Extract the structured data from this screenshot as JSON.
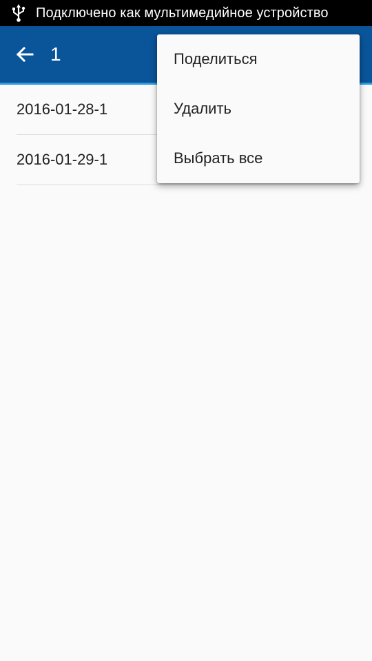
{
  "status_bar": {
    "icon": "usb-icon",
    "text": "Подключено как мультимедийное устройство"
  },
  "app_bar": {
    "back_icon": "arrow-left-icon",
    "title": "1",
    "color": "#0a5499",
    "accent": "#2f9be0"
  },
  "list": {
    "items": [
      {
        "label": "2016-01-28-1"
      },
      {
        "label": "2016-01-29-1"
      }
    ]
  },
  "menu": {
    "items": [
      {
        "label": "Поделиться"
      },
      {
        "label": "Удалить"
      },
      {
        "label": "Выбрать все"
      }
    ]
  }
}
